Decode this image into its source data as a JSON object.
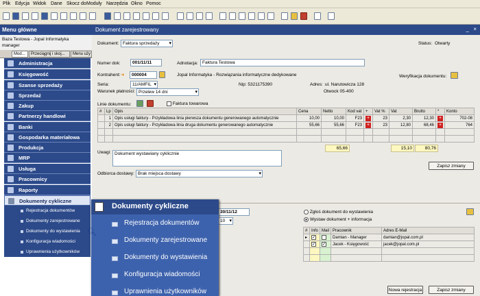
{
  "menu": [
    "Plik",
    "Edycja",
    "Widok",
    "Dane",
    "Skocz do",
    "Moduły",
    "Narzędzia",
    "Okno",
    "Pomoc"
  ],
  "sidebar": {
    "title": "Menu główne",
    "db_line": "Baza Testowa - Jopal Informatyka",
    "user": "manager",
    "tabs": [
      "Mod...",
      "Przeciągnij i skoj...",
      "Menu uży"
    ],
    "items": [
      "Administracja",
      "Księgowość",
      "Szanse sprzedaży",
      "Sprzedaż",
      "Zakup",
      "Partnerzy handlowi",
      "Banki",
      "Gospodarka materiałowa",
      "Produkcja",
      "MRP",
      "Usługa",
      "Pracownicy",
      "Raporty",
      "Dokumenty cykliczne"
    ],
    "subitems": [
      "Rejestracja dokumentów",
      "Dokumenty zarejestrowane",
      "Dokumenty do wystawienia",
      "Konfiguracja wiadomości",
      "Uprawnienia użytkowników"
    ]
  },
  "window": {
    "title": "Dokument zarejestrowany",
    "close": "×",
    "minimize": "_"
  },
  "form": {
    "dokument_label": "Dokument:",
    "dokument": "Faktura sprzedaży",
    "status_label": "Status:",
    "status": "Otwarty",
    "numer_label": "Numer dok:",
    "numer": "001/11/11",
    "adnotacja_label": "Adnotacja:",
    "adnotacja": "Faktura Testowa",
    "kontrahent_label": "Kontrahent:",
    "kontrahent": "000004",
    "kontrahent_name": "Jopal Informatyka - Rozwiązania informatyczne dedykowane",
    "weryfikacja": "Weryfikacja dokumentu:",
    "seria_label": "Seria:",
    "seria": "11/AMFIL",
    "nip_label": "Nip: 5321175390",
    "adres_label": "Adres:",
    "adres": "ul. Narutowicza 128",
    "otwock": "Otwock 05-400",
    "warunek_label": "Warunek płatności:",
    "warunek": "Przelew 14 dni",
    "linie_label": "Linie dokumentu:",
    "faktura_towarowa": "Faktura towarowa"
  },
  "table": {
    "headers": [
      "#",
      "Lp",
      "Opis",
      "Cena",
      "Netto",
      "Kod vat",
      "+",
      "Vat %",
      "Vat",
      "Brutto",
      "*",
      "Konto"
    ],
    "rows": [
      [
        "1",
        "Opis usługi faktury - Przykładowa linia pierwsza dokumentu generowanego automatycznie",
        "10,00",
        "10,00",
        "F23",
        "23",
        "2,30",
        "12,30",
        "702-08"
      ],
      [
        "2",
        "Opis usługi faktury - Przykładowa linia druga dokumentu generowanego automatycznie",
        "55,66",
        "55,66",
        "F23",
        "23",
        "12,80",
        "68,46",
        "764"
      ]
    ],
    "totals": {
      "netto": "65,66",
      "vat": "15,10",
      "brutto": "80,76"
    }
  },
  "uwagi_label": "Uwagi:",
  "uwagi": "Dokument wystawiany cyklicznie",
  "zapisz": "Zapisz zmiany",
  "odbiorca_label": "Odbiorca dostawy:",
  "odbiorca": "Brak miejsca dostawy",
  "cyclic": {
    "date": "30/11/12",
    "num": "10",
    "radio1": "Zgłoś dokument do wystawienia",
    "radio2": "Wystaw dokument + informacja",
    "headers": [
      "#",
      "Info",
      "Mail",
      "Pracownik",
      "Adres E-Mail"
    ],
    "rows": [
      [
        "Damian - Manager",
        "damian@jopal.com.pl"
      ],
      [
        "Jacek - Księgowość",
        "jacek@jopal.com.pl"
      ]
    ]
  },
  "buttons": {
    "nowa": "Nowa rejestracja",
    "zapisz2": "Zapisz zmiany"
  },
  "popup": {
    "title": "Dokumenty cykliczne",
    "items": [
      "Rejestracja dokumentów",
      "Dokumenty zarejestrowane",
      "Dokumenty do wystawienia",
      "Konfiguracja wiadomości",
      "Uprawnienia użytkowników"
    ]
  },
  "colors": {
    "nav_blue": "#2c4a8a",
    "popup_blue": "#3d62ad"
  }
}
